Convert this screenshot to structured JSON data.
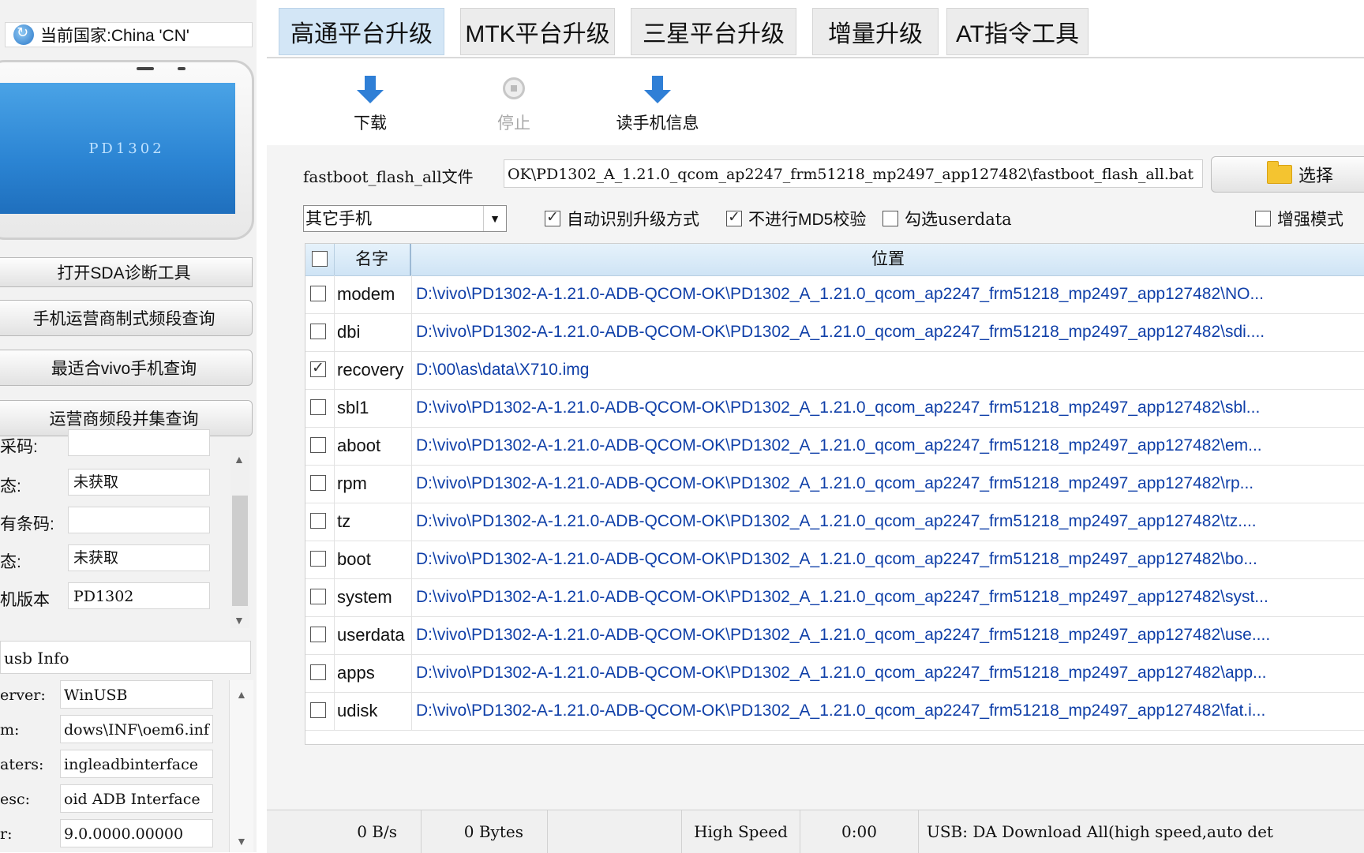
{
  "country": {
    "label": "当前国家:China 'CN'"
  },
  "phone_preview": {
    "model_text": "PD1302"
  },
  "left_buttons": {
    "sda": "打开SDA诊断工具",
    "carrier": "手机运营商制式频段查询",
    "best": "最适合vivo手机查询",
    "union": "运营商频段并集查询"
  },
  "device_info": [
    {
      "label": "采码:",
      "value": ""
    },
    {
      "label": "态:",
      "value": "未获取"
    },
    {
      "label": "有条码:",
      "value": ""
    },
    {
      "label": "态:",
      "value": "未获取"
    },
    {
      "label": "机版本",
      "value": "PD1302"
    }
  ],
  "usb_info": {
    "title": "usb Info"
  },
  "driver_info": [
    {
      "label": "erver:",
      "value": "WinUSB"
    },
    {
      "label": "m:",
      "value": "dows\\INF\\oem6.inf"
    },
    {
      "label": "aters:",
      "value": "ingleadbinterface"
    },
    {
      "label": "esc:",
      "value": "oid ADB Interface"
    },
    {
      "label": "r:",
      "value": "9.0.0000.00000"
    }
  ],
  "tabs": [
    {
      "label": "高通平台升级",
      "active": true
    },
    {
      "label": "MTK平台升级",
      "active": false
    },
    {
      "label": "三星平台升级",
      "active": false
    },
    {
      "label": "增量升级",
      "active": false
    },
    {
      "label": "AT指令工具",
      "active": false
    }
  ],
  "toolbar": {
    "download": "下载",
    "stop": "停止",
    "read_info": "读手机信息"
  },
  "file": {
    "label": "fastboot_flash_all文件",
    "path": "OK\\PD1302_A_1.21.0_qcom_ap2247_frm51218_mp2497_app127482\\fastboot_flash_all.bat",
    "choose": "选择"
  },
  "options": {
    "phone_type": "其它手机",
    "auto_detect": {
      "label": "自动识别升级方式",
      "checked": true
    },
    "no_md5": {
      "label": "不进行MD5校验",
      "checked": true
    },
    "userdata": {
      "label": "勾选userdata",
      "checked": false
    },
    "enhanced": {
      "label": "增强模式",
      "checked": false
    }
  },
  "grid": {
    "col_name": "名字",
    "col_location": "位置",
    "rows": [
      {
        "name": "modem",
        "checked": false,
        "path": "D:\\vivo\\PD1302-A-1.21.0-ADB-QCOM-OK\\PD1302_A_1.21.0_qcom_ap2247_frm51218_mp2497_app127482\\NO..."
      },
      {
        "name": "dbi",
        "checked": false,
        "path": "D:\\vivo\\PD1302-A-1.21.0-ADB-QCOM-OK\\PD1302_A_1.21.0_qcom_ap2247_frm51218_mp2497_app127482\\sdi...."
      },
      {
        "name": "recovery",
        "checked": true,
        "path": "D:\\00\\as\\data\\X710.img"
      },
      {
        "name": "sbl1",
        "checked": false,
        "path": "D:\\vivo\\PD1302-A-1.21.0-ADB-QCOM-OK\\PD1302_A_1.21.0_qcom_ap2247_frm51218_mp2497_app127482\\sbl..."
      },
      {
        "name": "aboot",
        "checked": false,
        "path": "D:\\vivo\\PD1302-A-1.21.0-ADB-QCOM-OK\\PD1302_A_1.21.0_qcom_ap2247_frm51218_mp2497_app127482\\em..."
      },
      {
        "name": "rpm",
        "checked": false,
        "path": "D:\\vivo\\PD1302-A-1.21.0-ADB-QCOM-OK\\PD1302_A_1.21.0_qcom_ap2247_frm51218_mp2497_app127482\\rp..."
      },
      {
        "name": "tz",
        "checked": false,
        "path": "D:\\vivo\\PD1302-A-1.21.0-ADB-QCOM-OK\\PD1302_A_1.21.0_qcom_ap2247_frm51218_mp2497_app127482\\tz...."
      },
      {
        "name": "boot",
        "checked": false,
        "path": "D:\\vivo\\PD1302-A-1.21.0-ADB-QCOM-OK\\PD1302_A_1.21.0_qcom_ap2247_frm51218_mp2497_app127482\\bo..."
      },
      {
        "name": "system",
        "checked": false,
        "path": "D:\\vivo\\PD1302-A-1.21.0-ADB-QCOM-OK\\PD1302_A_1.21.0_qcom_ap2247_frm51218_mp2497_app127482\\syst..."
      },
      {
        "name": "userdata",
        "checked": false,
        "path": "D:\\vivo\\PD1302-A-1.21.0-ADB-QCOM-OK\\PD1302_A_1.21.0_qcom_ap2247_frm51218_mp2497_app127482\\use...."
      },
      {
        "name": "apps",
        "checked": false,
        "path": "D:\\vivo\\PD1302-A-1.21.0-ADB-QCOM-OK\\PD1302_A_1.21.0_qcom_ap2247_frm51218_mp2497_app127482\\app..."
      },
      {
        "name": "udisk",
        "checked": false,
        "path": "D:\\vivo\\PD1302-A-1.21.0-ADB-QCOM-OK\\PD1302_A_1.21.0_qcom_ap2247_frm51218_mp2497_app127482\\fat.i..."
      }
    ]
  },
  "status": {
    "speed": "0 B/s",
    "bytes": "0 Bytes",
    "usb_speed": "High Speed",
    "time": "0:00",
    "message": "USB: DA Download All(high speed,auto det"
  },
  "colors": {
    "active_tab": "#d3e6f6",
    "path_text": "#0f3fa8",
    "arrow": "#2f7fd6"
  }
}
